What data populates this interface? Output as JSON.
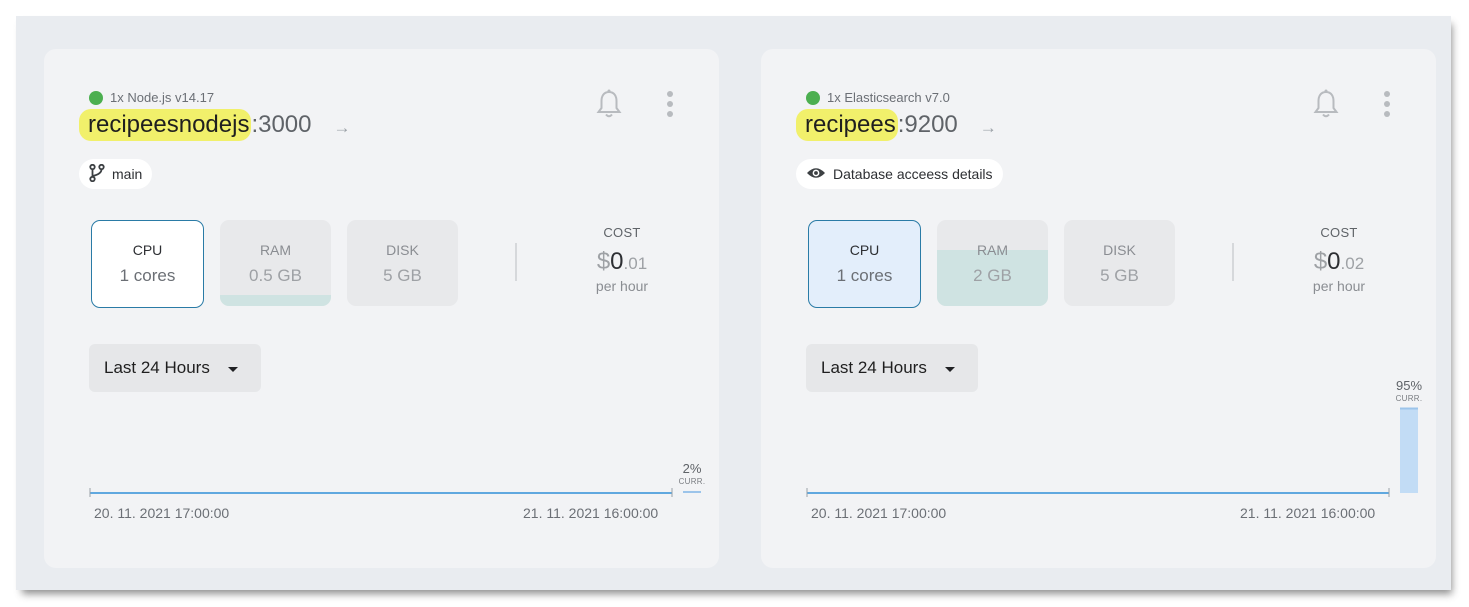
{
  "services": [
    {
      "status_text": "1x Node.js v14.17",
      "status_color": "#4caf50",
      "name": "recipeesnodejs",
      "port": ":3000",
      "chip_label": "main",
      "chip_icon": "branch-icon",
      "metrics": [
        {
          "label": "CPU",
          "value": "1 cores",
          "active": true,
          "fill_fraction": 0
        },
        {
          "label": "RAM",
          "value": "0.5 GB",
          "active": false,
          "fill_fraction": 0.13
        },
        {
          "label": "DISK",
          "value": "5 GB",
          "active": false,
          "fill_fraction": 0
        }
      ],
      "cost": {
        "label": "COST",
        "currency": "$",
        "integer": "0",
        "decimal": ".01",
        "unit": "per hour"
      },
      "time_range": "Last 24 Hours",
      "chart": {
        "current_value": "2%",
        "current_tag": "CURR.",
        "current_fraction": 0.02,
        "x_start": "20. 11. 2021 17:00:00",
        "x_end": "21. 11. 2021 16:00:00"
      }
    },
    {
      "status_text": "1x Elasticsearch v7.0",
      "status_color": "#4caf50",
      "name": "recipees",
      "port": ":9200",
      "chip_label": "Database acceess details",
      "chip_icon": "eye-icon",
      "metrics": [
        {
          "label": "CPU",
          "value": "1 cores",
          "active": true,
          "fill_fraction": 0
        },
        {
          "label": "RAM",
          "value": "2 GB",
          "active": false,
          "fill_fraction": 0.65
        },
        {
          "label": "DISK",
          "value": "5 GB",
          "active": false,
          "fill_fraction": 0
        }
      ],
      "cost": {
        "label": "COST",
        "currency": "$",
        "integer": "0",
        "decimal": ".02",
        "unit": "per hour"
      },
      "time_range": "Last 24 Hours",
      "chart": {
        "current_value": "95%",
        "current_tag": "CURR.",
        "current_fraction": 0.95,
        "x_start": "20. 11. 2021 17:00:00",
        "x_end": "21. 11. 2021 16:00:00"
      }
    }
  ]
}
